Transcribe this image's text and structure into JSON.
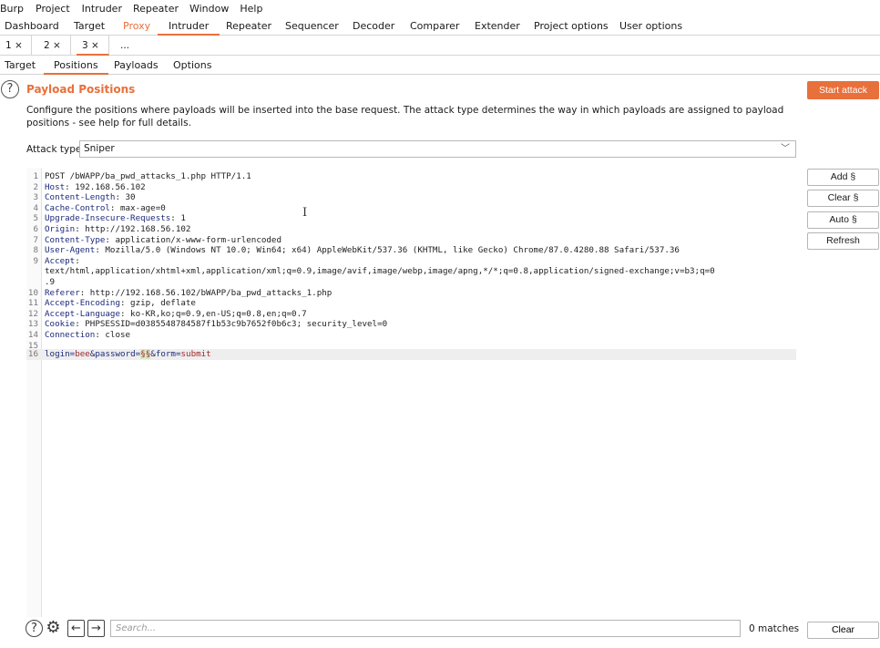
{
  "menu": [
    "Burp",
    "Project",
    "Intruder",
    "Repeater",
    "Window",
    "Help"
  ],
  "main_tabs": [
    "Dashboard",
    "Target",
    "Proxy",
    "Intruder",
    "Repeater",
    "Sequencer",
    "Decoder",
    "Comparer",
    "Extender",
    "Project options",
    "User options"
  ],
  "instance_tabs": [
    "1 ×",
    "2 ×",
    "3 ×",
    "..."
  ],
  "sub_tabs": [
    "Target",
    "Positions",
    "Payloads",
    "Options"
  ],
  "section": {
    "help_glyph": "?",
    "title": "Payload Positions",
    "start_attack": "Start attack",
    "description": "Configure the positions where payloads will be inserted into the base request. The attack type determines the way in which payloads are assigned to payload positions - see help for full details."
  },
  "attack_type": {
    "label": "Attack type:",
    "value": "Sniper",
    "chevron": "﹀"
  },
  "request_lines": [
    {
      "n": "1",
      "key": "",
      "val": "POST /bWAPP/ba_pwd_attacks_1.php HTTP/1.1"
    },
    {
      "n": "2",
      "key": "Host",
      "val": ": 192.168.56.102"
    },
    {
      "n": "3",
      "key": "Content-Length",
      "val": ": 30"
    },
    {
      "n": "4",
      "key": "Cache-Control",
      "val": ": max-age=0"
    },
    {
      "n": "5",
      "key": "Upgrade-Insecure-Requests",
      "val": ": 1"
    },
    {
      "n": "6",
      "key": "Origin",
      "val": ": http://192.168.56.102"
    },
    {
      "n": "7",
      "key": "Content-Type",
      "val": ": application/x-www-form-urlencoded"
    },
    {
      "n": "8",
      "key": "User-Agent",
      "val": ": Mozilla/5.0 (Windows NT 10.0; Win64; x64) AppleWebKit/537.36 (KHTML, like Gecko) Chrome/87.0.4280.88 Safari/537.36"
    },
    {
      "n": "9",
      "key": "Accept",
      "val": ":"
    },
    {
      "n": "",
      "key": "",
      "val": "text/html,application/xhtml+xml,application/xml;q=0.9,image/avif,image/webp,image/apng,*/*;q=0.8,application/signed-exchange;v=b3;q=0"
    },
    {
      "n": "",
      "key": "",
      "val": ".9"
    },
    {
      "n": "10",
      "key": "Referer",
      "val": ": http://192.168.56.102/bWAPP/ba_pwd_attacks_1.php"
    },
    {
      "n": "11",
      "key": "Accept-Encoding",
      "val": ": gzip, deflate"
    },
    {
      "n": "12",
      "key": "Accept-Language",
      "val": ": ko-KR,ko;q=0.9,en-US;q=0.8,en;q=0.7"
    },
    {
      "n": "13",
      "key": "Cookie",
      "val": ": PHPSESSID=d0385548784587f1b53c9b7652f0b6c3; security_level=0"
    },
    {
      "n": "14",
      "key": "Connection",
      "val": ": close"
    },
    {
      "n": "15",
      "key": "",
      "val": ""
    }
  ],
  "body_line": {
    "n": "16",
    "k1": "login",
    "eq1": "=",
    "v1": "bee",
    "amp1": "&",
    "k2": "password",
    "eq2": "=",
    "marker": "§§",
    "amp2": "&",
    "k3": "form",
    "eq3": "=",
    "v3": "submit"
  },
  "side_buttons": [
    "Add §",
    "Clear §",
    "Auto §",
    "Refresh"
  ],
  "cursor_glyph": "I",
  "bottom": {
    "help_glyph": "?",
    "gear_glyph": "⚙",
    "back_glyph": "←",
    "forward_glyph": "→",
    "search_placeholder": "Search...",
    "matches": "0 matches",
    "clear": "Clear"
  }
}
